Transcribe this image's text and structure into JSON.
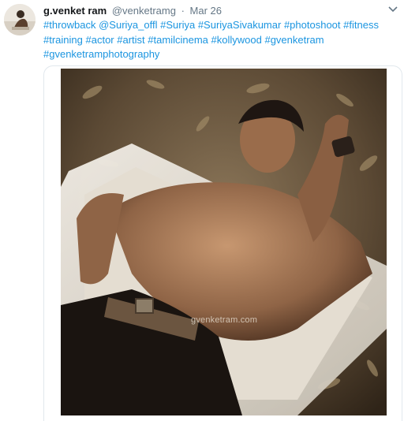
{
  "tweet": {
    "author_name": "g.venket ram",
    "author_handle": "@venketramg",
    "separator": "·",
    "timestamp": "Mar 26",
    "hashtags": [
      "#throwback",
      "@Suriya_offl",
      "#Suriya",
      "#SuriyaSivakumar",
      "#photoshoot",
      "#fitness",
      "#training",
      "#actor",
      "#artist",
      "#tamilcinema",
      "#kollywood",
      "#gvenketram",
      "#gvenketramphotography"
    ]
  },
  "media": {
    "watermark": "gvenketram.com"
  },
  "icons": {
    "caret": "chevron-down-icon"
  },
  "colors": {
    "link": "#1b95e0",
    "muted": "#657786",
    "text": "#14171a"
  }
}
